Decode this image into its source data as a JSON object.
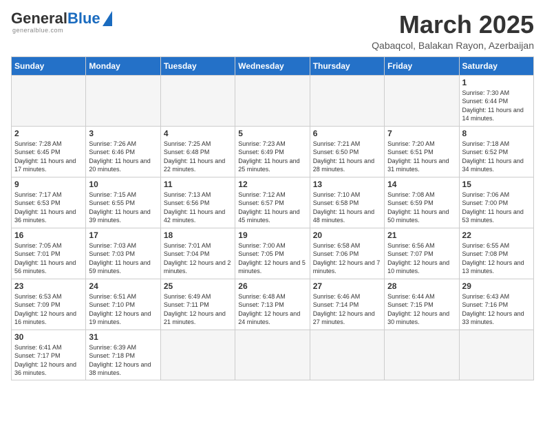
{
  "logo": {
    "general": "General",
    "blue": "Blue",
    "subtitle": "generalblue.com"
  },
  "title": {
    "month": "March 2025",
    "location": "Qabaqcol, Balakan Rayon, Azerbaijan"
  },
  "weekdays": [
    "Sunday",
    "Monday",
    "Tuesday",
    "Wednesday",
    "Thursday",
    "Friday",
    "Saturday"
  ],
  "days": [
    {
      "num": "",
      "info": ""
    },
    {
      "num": "",
      "info": ""
    },
    {
      "num": "",
      "info": ""
    },
    {
      "num": "",
      "info": ""
    },
    {
      "num": "",
      "info": ""
    },
    {
      "num": "",
      "info": ""
    },
    {
      "num": "1",
      "sunrise": "7:30 AM",
      "sunset": "6:44 PM",
      "daylight": "11 hours and 14 minutes."
    },
    {
      "num": "2",
      "sunrise": "7:28 AM",
      "sunset": "6:45 PM",
      "daylight": "11 hours and 17 minutes."
    },
    {
      "num": "3",
      "sunrise": "7:26 AM",
      "sunset": "6:46 PM",
      "daylight": "11 hours and 20 minutes."
    },
    {
      "num": "4",
      "sunrise": "7:25 AM",
      "sunset": "6:48 PM",
      "daylight": "11 hours and 22 minutes."
    },
    {
      "num": "5",
      "sunrise": "7:23 AM",
      "sunset": "6:49 PM",
      "daylight": "11 hours and 25 minutes."
    },
    {
      "num": "6",
      "sunrise": "7:21 AM",
      "sunset": "6:50 PM",
      "daylight": "11 hours and 28 minutes."
    },
    {
      "num": "7",
      "sunrise": "7:20 AM",
      "sunset": "6:51 PM",
      "daylight": "11 hours and 31 minutes."
    },
    {
      "num": "8",
      "sunrise": "7:18 AM",
      "sunset": "6:52 PM",
      "daylight": "11 hours and 34 minutes."
    },
    {
      "num": "9",
      "sunrise": "7:17 AM",
      "sunset": "6:53 PM",
      "daylight": "11 hours and 36 minutes."
    },
    {
      "num": "10",
      "sunrise": "7:15 AM",
      "sunset": "6:55 PM",
      "daylight": "11 hours and 39 minutes."
    },
    {
      "num": "11",
      "sunrise": "7:13 AM",
      "sunset": "6:56 PM",
      "daylight": "11 hours and 42 minutes."
    },
    {
      "num": "12",
      "sunrise": "7:12 AM",
      "sunset": "6:57 PM",
      "daylight": "11 hours and 45 minutes."
    },
    {
      "num": "13",
      "sunrise": "7:10 AM",
      "sunset": "6:58 PM",
      "daylight": "11 hours and 48 minutes."
    },
    {
      "num": "14",
      "sunrise": "7:08 AM",
      "sunset": "6:59 PM",
      "daylight": "11 hours and 50 minutes."
    },
    {
      "num": "15",
      "sunrise": "7:06 AM",
      "sunset": "7:00 PM",
      "daylight": "11 hours and 53 minutes."
    },
    {
      "num": "16",
      "sunrise": "7:05 AM",
      "sunset": "7:01 PM",
      "daylight": "11 hours and 56 minutes."
    },
    {
      "num": "17",
      "sunrise": "7:03 AM",
      "sunset": "7:03 PM",
      "daylight": "11 hours and 59 minutes."
    },
    {
      "num": "18",
      "sunrise": "7:01 AM",
      "sunset": "7:04 PM",
      "daylight": "12 hours and 2 minutes."
    },
    {
      "num": "19",
      "sunrise": "7:00 AM",
      "sunset": "7:05 PM",
      "daylight": "12 hours and 5 minutes."
    },
    {
      "num": "20",
      "sunrise": "6:58 AM",
      "sunset": "7:06 PM",
      "daylight": "12 hours and 7 minutes."
    },
    {
      "num": "21",
      "sunrise": "6:56 AM",
      "sunset": "7:07 PM",
      "daylight": "12 hours and 10 minutes."
    },
    {
      "num": "22",
      "sunrise": "6:55 AM",
      "sunset": "7:08 PM",
      "daylight": "12 hours and 13 minutes."
    },
    {
      "num": "23",
      "sunrise": "6:53 AM",
      "sunset": "7:09 PM",
      "daylight": "12 hours and 16 minutes."
    },
    {
      "num": "24",
      "sunrise": "6:51 AM",
      "sunset": "7:10 PM",
      "daylight": "12 hours and 19 minutes."
    },
    {
      "num": "25",
      "sunrise": "6:49 AM",
      "sunset": "7:11 PM",
      "daylight": "12 hours and 21 minutes."
    },
    {
      "num": "26",
      "sunrise": "6:48 AM",
      "sunset": "7:13 PM",
      "daylight": "12 hours and 24 minutes."
    },
    {
      "num": "27",
      "sunrise": "6:46 AM",
      "sunset": "7:14 PM",
      "daylight": "12 hours and 27 minutes."
    },
    {
      "num": "28",
      "sunrise": "6:44 AM",
      "sunset": "7:15 PM",
      "daylight": "12 hours and 30 minutes."
    },
    {
      "num": "29",
      "sunrise": "6:43 AM",
      "sunset": "7:16 PM",
      "daylight": "12 hours and 33 minutes."
    },
    {
      "num": "30",
      "sunrise": "6:41 AM",
      "sunset": "7:17 PM",
      "daylight": "12 hours and 36 minutes."
    },
    {
      "num": "31",
      "sunrise": "6:39 AM",
      "sunset": "7:18 PM",
      "daylight": "12 hours and 38 minutes."
    },
    {
      "num": "",
      "info": ""
    },
    {
      "num": "",
      "info": ""
    },
    {
      "num": "",
      "info": ""
    },
    {
      "num": "",
      "info": ""
    },
    {
      "num": "",
      "info": ""
    }
  ]
}
